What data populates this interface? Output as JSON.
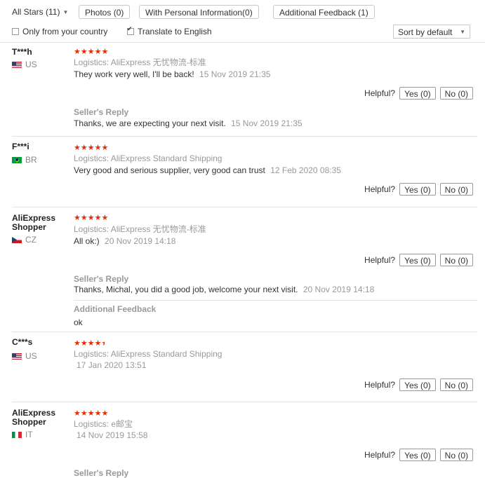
{
  "filters": {
    "stars_label": "All Stars (11)",
    "photos": "Photos (0)",
    "personal_info": "With Personal Information(0)",
    "additional_feedback": "Additional Feedback (1)",
    "only_country": "Only from your country",
    "translate": "Translate to English",
    "sort": "Sort by default"
  },
  "helpful_label": "Helpful?",
  "reviews": [
    {
      "user": "T***h",
      "country": "US",
      "stars": "★★★★★",
      "logistics_label": "Logistics:",
      "logistics": "AliExpress 无忧物流-标准",
      "text": "They work very well, I'll be back!",
      "date": "15 Nov 2019 21:35",
      "yes": "Yes (0)",
      "no": "No (0)",
      "reply_label": "Seller's Reply",
      "reply": "Thanks, we are expecting your next visit.",
      "reply_date": "15 Nov 2019 21:35"
    },
    {
      "user": "F***i",
      "country": "BR",
      "stars": "★★★★★",
      "logistics_label": "Logistics:",
      "logistics": "AliExpress Standard Shipping",
      "text": "Very good and serious supplier, very good can trust",
      "date": "12 Feb 2020 08:35",
      "yes": "Yes (0)",
      "no": "No (0)"
    },
    {
      "user": "AliExpress Shopper",
      "country": "CZ",
      "stars": "★★★★★",
      "logistics_label": "Logistics:",
      "logistics": "AliExpress 无忧物流-标准",
      "text": "All ok:)",
      "date": "20 Nov 2019 14:18",
      "yes": "Yes (0)",
      "no": "No (0)",
      "reply_label": "Seller's Reply",
      "reply": "Thanks, Michal, you did a good job, welcome your next visit.",
      "reply_date": "20 Nov 2019 14:18",
      "additional_label": "Additional Feedback",
      "additional": "ok"
    },
    {
      "user": "C***s",
      "country": "US",
      "stars": "★★★★",
      "rating": 4.5,
      "logistics_label": "Logistics:",
      "logistics": "AliExpress Standard Shipping",
      "date": "17 Jan 2020 13:51",
      "yes": "Yes (0)",
      "no": "No (0)"
    },
    {
      "user": "AliExpress Shopper",
      "country": "IT",
      "stars": "★★★★★",
      "logistics_label": "Logistics:",
      "logistics": "e邮宝",
      "date": "14 Nov 2019 15:58",
      "yes": "Yes (0)",
      "no": "No (0)",
      "reply_label": "Seller's Reply"
    }
  ]
}
